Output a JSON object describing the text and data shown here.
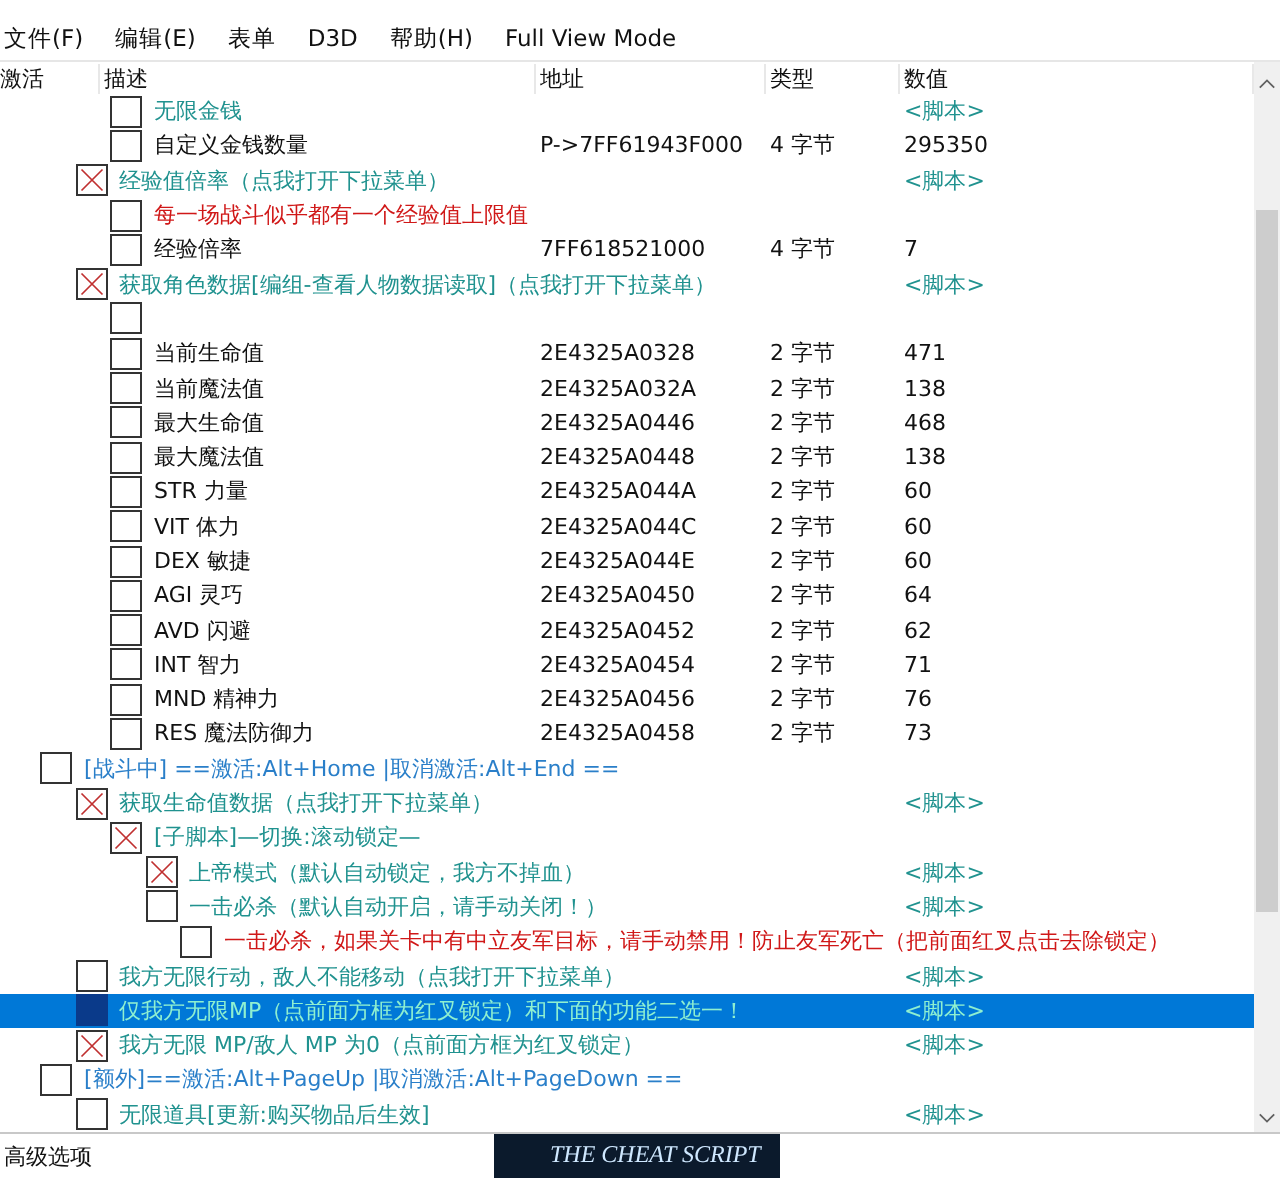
{
  "menu": [
    "文件(F)",
    "编辑(E)",
    "表单",
    "D3D",
    "帮助(H)",
    "Full View Mode"
  ],
  "columns": [
    "激活",
    "描述",
    "地址",
    "类型",
    "数值"
  ],
  "rows": [
    {
      "children": [
        {
          "children": [
            {
              "kind": "script",
              "checked": false,
              "selected": false,
              "description": "无限金钱",
              "value": "<脚本>"
            },
            {
              "kind": "value",
              "checked": false,
              "selected": false,
              "description": "自定义金钱数量",
              "address": "P->7FF61943F000",
              "type": "4 字节",
              "value": "295350"
            }
          ]
        },
        {
          "kind": "script",
          "checked": true,
          "selected": false,
          "description": "经验值倍率（点我打开下拉菜单）",
          "value": "<脚本>",
          "children": [
            {
              "kind": "note",
              "checked": false,
              "selected": false,
              "description": "每一场战斗似乎都有一个经验值上限值"
            },
            {
              "kind": "value",
              "checked": false,
              "selected": false,
              "description": "经验倍率",
              "address": "7FF618521000",
              "type": "4 字节",
              "value": "7"
            }
          ]
        },
        {
          "kind": "script",
          "checked": true,
          "selected": false,
          "description": "获取角色数据[编组-查看人物数据读取]（点我打开下拉菜单）",
          "value": "<脚本>",
          "children": [
            {
              "kind": "value",
              "checked": false,
              "selected": false
            },
            {
              "kind": "value",
              "checked": false,
              "selected": false,
              "description": "当前生命值",
              "address": "2E4325A0328",
              "type": "2 字节",
              "value": "471"
            },
            {
              "kind": "value",
              "checked": false,
              "selected": false,
              "description": "当前魔法值",
              "address": "2E4325A032A",
              "type": "2 字节",
              "value": "138"
            },
            {
              "kind": "value",
              "checked": false,
              "selected": false,
              "description": "最大生命值",
              "address": "2E4325A0446",
              "type": "2 字节",
              "value": "468"
            },
            {
              "kind": "value",
              "checked": false,
              "selected": false,
              "description": "最大魔法值",
              "address": "2E4325A0448",
              "type": "2 字节",
              "value": "138"
            },
            {
              "kind": "value",
              "checked": false,
              "selected": false,
              "description": "STR 力量",
              "address": "2E4325A044A",
              "type": "2 字节",
              "value": "60"
            },
            {
              "kind": "value",
              "checked": false,
              "selected": false,
              "description": "VIT  体力",
              "address": "2E4325A044C",
              "type": "2 字节",
              "value": "60"
            },
            {
              "kind": "value",
              "checked": false,
              "selected": false,
              "description": "DEX 敏捷",
              "address": "2E4325A044E",
              "type": "2 字节",
              "value": "60"
            },
            {
              "kind": "value",
              "checked": false,
              "selected": false,
              "description": "AGI 灵巧",
              "address": "2E4325A0450",
              "type": "2 字节",
              "value": "64"
            },
            {
              "kind": "value",
              "checked": false,
              "selected": false,
              "description": "AVD 闪避",
              "address": "2E4325A0452",
              "type": "2 字节",
              "value": "62"
            },
            {
              "kind": "value",
              "checked": false,
              "selected": false,
              "description": "INT 智力",
              "address": "2E4325A0454",
              "type": "2 字节",
              "value": "71"
            },
            {
              "kind": "value",
              "checked": false,
              "selected": false,
              "description": "MND 精神力",
              "address": "2E4325A0456",
              "type": "2 字节",
              "value": "76"
            },
            {
              "kind": "value",
              "checked": false,
              "selected": false,
              "description": "RES 魔法防御力",
              "address": "2E4325A0458",
              "type": "2 字节",
              "value": "73"
            }
          ]
        }
      ]
    },
    {
      "kind": "group",
      "checked": false,
      "selected": false,
      "description": "[战斗中] ==激活:Alt+Home |取消激活:Alt+End ==",
      "children": [
        {
          "kind": "script",
          "checked": true,
          "selected": false,
          "description": "获取生命值数据（点我打开下拉菜单）",
          "value": "<脚本>",
          "children": [
            {
              "kind": "script",
              "checked": true,
              "selected": false,
              "description": "[子脚本]—切换:滚动锁定—",
              "children": [
                {
                  "kind": "script",
                  "checked": true,
                  "selected": false,
                  "description": "上帝模式（默认自动锁定，我方不掉血）",
                  "value": "<脚本>"
                },
                {
                  "kind": "script",
                  "checked": false,
                  "selected": false,
                  "description": "一击必杀（默认自动开启，请手动关闭！）",
                  "value": "<脚本>",
                  "children": [
                    {
                      "kind": "note",
                      "checked": false,
                      "selected": false,
                      "description": "一击必杀，如果关卡中有中立友军目标，请手动禁用！防止友军死亡（把前面红叉点击去除锁定）"
                    }
                  ]
                }
              ]
            }
          ]
        },
        {
          "kind": "script",
          "checked": false,
          "selected": false,
          "description": "我方无限行动，敌人不能移动（点我打开下拉菜单）",
          "value": "<脚本>"
        },
        {
          "kind": "script",
          "checked": false,
          "selected": true,
          "description": "仅我方无限MP（点前面方框为红叉锁定）和下面的功能二选一！",
          "value": "<脚本>"
        },
        {
          "kind": "script",
          "checked": true,
          "selected": false,
          "description": "我方无限 MP/敌人 MP 为0（点前面方框为红叉锁定）",
          "value": "<脚本>"
        }
      ]
    },
    {
      "kind": "group",
      "checked": false,
      "selected": false,
      "description": "[额外]==激活:Alt+PageUp |取消激活:Alt+PageDown ==",
      "children": [
        {
          "kind": "script",
          "checked": false,
          "selected": false,
          "description": "无限道具[更新:购买物品后生效]",
          "value": "<脚本>"
        }
      ]
    }
  ],
  "footer": {
    "advanced": "高级选项",
    "banner": "THE CHEAT SCRIPT"
  }
}
